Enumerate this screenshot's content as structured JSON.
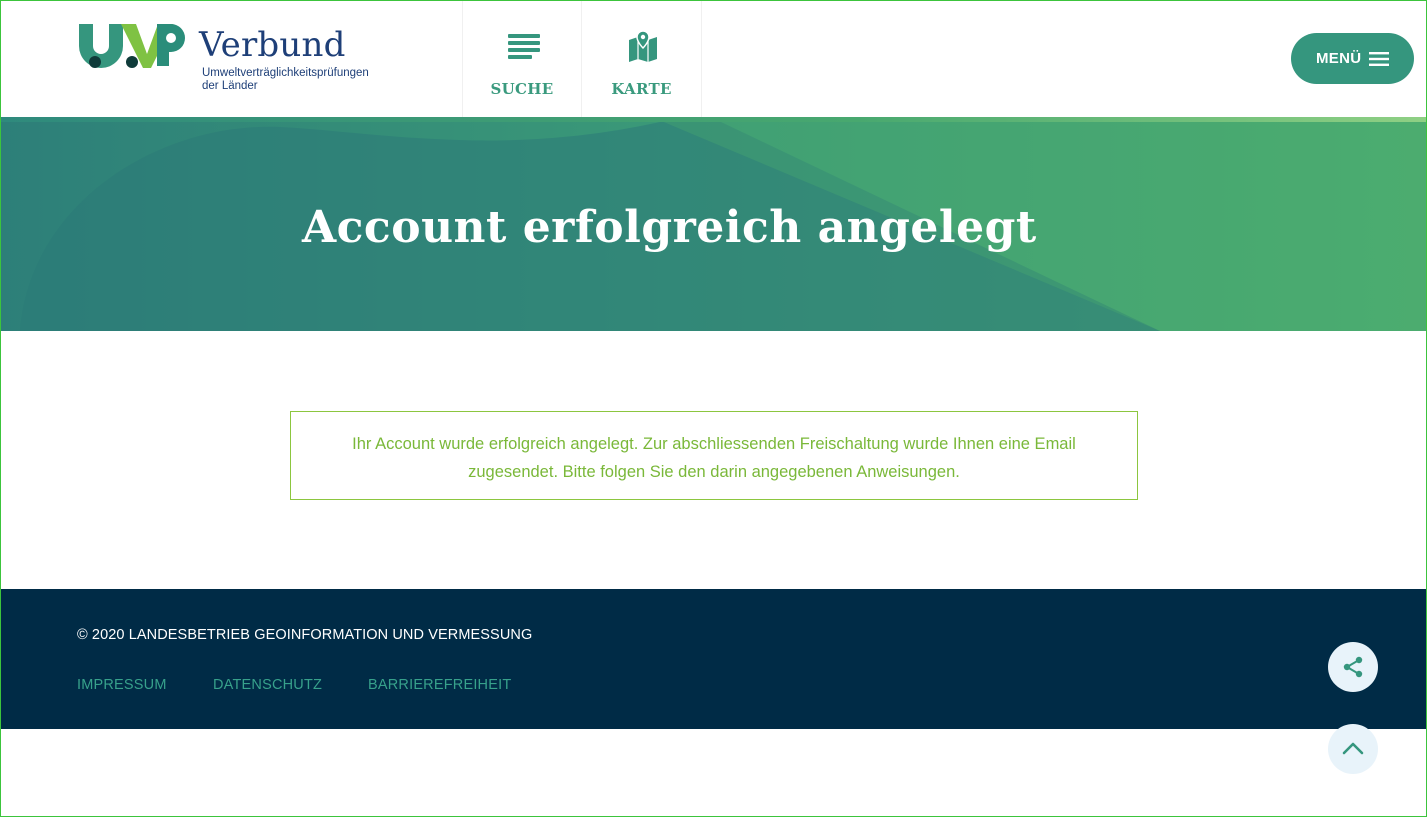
{
  "header": {
    "logo": {
      "wordmark": "UVP",
      "name": "Verbund",
      "subtitle": "Umweltverträglichkeitsprüfungen der Länder",
      "icon": "uvp-logo"
    },
    "nav": [
      {
        "label": "SUCHE",
        "icon": "list-lines-icon"
      },
      {
        "label": "KARTE",
        "icon": "map-pin-icon"
      }
    ],
    "menu_label": "MENÜ",
    "menu_icon": "hamburger-icon"
  },
  "hero": {
    "title": "Account erfolgreich angelegt"
  },
  "message": {
    "text": "Ihr Account wurde erfolgreich angelegt. Zur abschliessenden Freischaltung wurde Ihnen eine Email zugesendet. Bitte folgen Sie den darin angegebenen Anweisungen."
  },
  "footer": {
    "copyright": "© 2020 LANDESBETRIEB GEOINFORMATION UND VERMESSUNG",
    "links": [
      "IMPRESSUM",
      "DATENSCHUTZ",
      "BARRIEREFREIHEIT"
    ]
  },
  "floating": {
    "share_icon": "share-icon",
    "top_icon": "chevron-up-icon"
  },
  "colors": {
    "brand_green": "#35967e",
    "brand_navy": "#1e3f78",
    "message_green": "#7ab839",
    "footer_bg": "#002b46"
  }
}
